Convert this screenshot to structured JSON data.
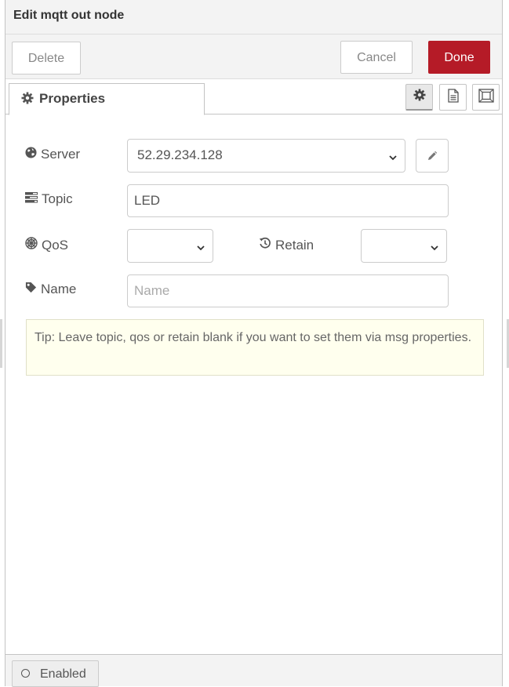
{
  "tray": {
    "title": "Edit mqtt out node"
  },
  "toolbar": {
    "delete_label": "Delete",
    "cancel_label": "Cancel",
    "done_label": "Done"
  },
  "tabs": {
    "properties_label": "Properties",
    "icons": [
      "gear-icon",
      "document-icon",
      "frame-icon"
    ]
  },
  "form": {
    "server": {
      "label": "Server",
      "value": "52.29.234.128",
      "icon": "globe-icon"
    },
    "topic": {
      "label": "Topic",
      "value": "LED",
      "icon": "tasks-icon"
    },
    "qos": {
      "label": "QoS",
      "value": "",
      "icon": "empire-icon"
    },
    "retain": {
      "label": "Retain",
      "value": "",
      "icon": "history-icon"
    },
    "name": {
      "label": "Name",
      "value": "",
      "placeholder": "Name",
      "icon": "tag-icon"
    }
  },
  "tip": {
    "text": "Tip: Leave topic, qos or retain blank if you want to set them via msg properties."
  },
  "footer": {
    "enabled_label": "Enabled"
  },
  "colors": {
    "done_button": "#b51b27",
    "tip_background": "#ffffee",
    "header_background": "#f3f3f3"
  }
}
